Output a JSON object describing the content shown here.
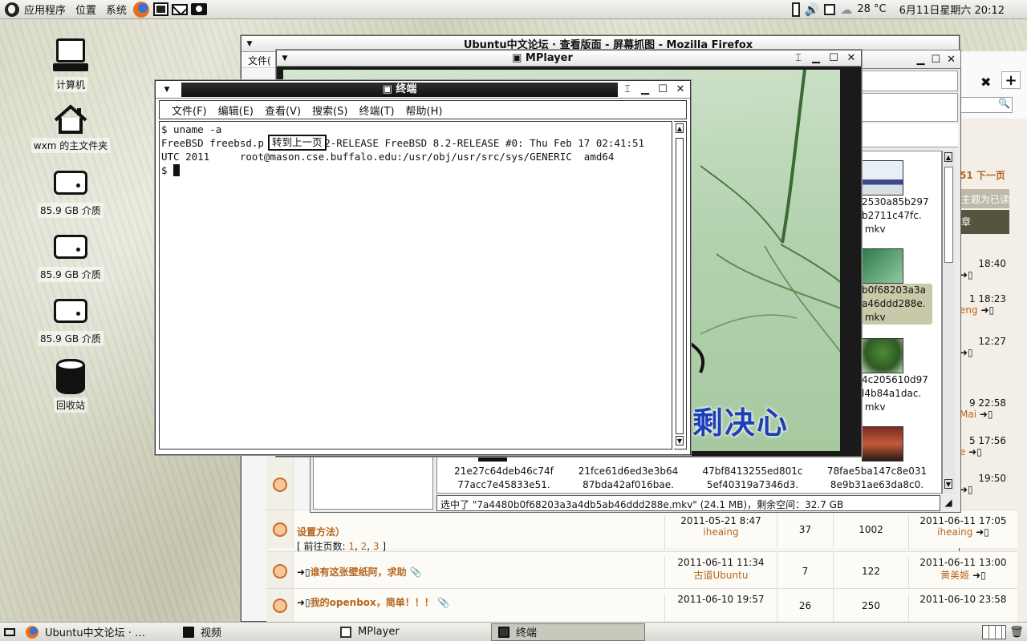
{
  "top_panel": {
    "menus": [
      "应用程序",
      "位置",
      "系统"
    ],
    "launchers": [
      "firefox-icon",
      "workspace-icon",
      "mail-icon",
      "camera-icon"
    ],
    "temperature": "28 °C",
    "datetime": "6月11日星期六 20:12"
  },
  "desktop": {
    "icons": [
      {
        "label": "计算机",
        "icon": "computer-icon"
      },
      {
        "label": "wxm 的主文件夹",
        "icon": "home-folder-icon"
      },
      {
        "label": "85.9 GB 介质",
        "icon": "drive-icon"
      },
      {
        "label": "85.9 GB 介质",
        "icon": "drive-icon"
      },
      {
        "label": "85.9 GB 介质",
        "icon": "drive-icon"
      },
      {
        "label": "回收站",
        "icon": "trash-icon"
      }
    ]
  },
  "firefox": {
    "title": "Ubuntu中文论坛 · 查看版面 - 屏幕抓图 - Mozilla Firefox",
    "menu_first": "文件(",
    "tab_close": "✖",
    "tab_add": "+",
    "next_page": "51 下一页",
    "mark_read": "主题为已读",
    "chapter": "章",
    "side_entries": [
      {
        "time": "18:40",
        "user": ""
      },
      {
        "time": "1 18:23",
        "user": "eng"
      },
      {
        "time": "12:27",
        "user": ""
      },
      {
        "time": "9 22:58",
        "user": "Mai"
      },
      {
        "time": "5 17:56",
        "user": "e"
      },
      {
        "time": "19:50",
        "user": ""
      }
    ],
    "rows": [
      {
        "subject": "设置方法）",
        "pages_prefix": "[ 前往页数: ",
        "pages": [
          "1",
          "2",
          "3"
        ],
        "pages_suffix": " ]",
        "created_date": "2011-05-21 8:47",
        "created_user": "iheaing",
        "replies": "37",
        "views": "1002",
        "last_date": "2011-06-11 17:05",
        "last_user": "iheaing"
      },
      {
        "subject": "谁有这张壁纸阿，求助",
        "pages_prefix": "",
        "pages": [],
        "pages_suffix": "",
        "created_date": "2011-06-11 11:34",
        "created_user": "古道Ubuntu",
        "replies": "7",
        "views": "122",
        "last_date": "2011-06-11 13:00",
        "last_user": "黄美姬"
      },
      {
        "subject": "我的openbox，简单！！！",
        "pages_prefix": "",
        "pages": [],
        "pages_suffix": "",
        "created_date": "2011-06-10 19:57",
        "created_user": "",
        "replies": "26",
        "views": "250",
        "last_date": "2011-06-10 23:58",
        "last_user": ""
      }
    ]
  },
  "file_chooser": {
    "thumbs_right": [
      {
        "lines": [
          "2530a85b297",
          "b2711c47fc.",
          "mkv"
        ],
        "selected": false
      },
      {
        "lines": [
          "b0f68203a3a",
          "a46ddd288e.",
          "mkv"
        ],
        "selected": true
      },
      {
        "lines": [
          "4c205610d97",
          "l4b84a1dac.",
          "mkv"
        ],
        "selected": false
      }
    ],
    "thumbs_bottom": [
      [
        "21e27c64deb46c74f",
        "77acc7e45833e51."
      ],
      [
        "21fce61d6ed3e3b64",
        "87bda42af016bae."
      ],
      [
        "47bf8413255ed801c",
        "5ef40319a7346d3."
      ],
      [
        "78fae5ba147c8e031",
        "8e9b31ae63da8c0."
      ]
    ],
    "status": "选中了 \"7a4480b0f68203a3a4db5ab46ddd288e.mkv\"  (24.1 MB)，剩余空间：32.7 GB"
  },
  "mplayer": {
    "title": "MPlayer",
    "subtitle": "剩决心"
  },
  "terminal": {
    "title": "终端",
    "menus": [
      "文件(F)",
      "编辑(E)",
      "查看(V)",
      "搜索(S)",
      "终端(T)",
      "帮助(H)"
    ],
    "lines": [
      "$ uname -a",
      "FreeBSD freebsd.p          2-RELEASE FreeBSD 8.2-RELEASE #0: Thu Feb 17 02:41:51",
      "UTC 2011     root@mason.cse.buffalo.edu:/usr/obj/usr/src/sys/GENERIC  amd64",
      "$ "
    ],
    "tooltip": "转到上一页"
  },
  "taskbar": {
    "tasks": [
      {
        "label": "Ubuntu中文论坛 · …",
        "icon": "firefox-icon",
        "active": false
      },
      {
        "label": "视频",
        "icon": "folder-icon",
        "active": false
      },
      {
        "label": "MPlayer",
        "icon": "window-icon",
        "active": false
      },
      {
        "label": "终端",
        "icon": "terminal-icon",
        "active": true
      }
    ]
  },
  "colors": {
    "accent_link": "#b5651d",
    "subtitle_blue": "#1d3fb7",
    "video_green": "#b2d2ae",
    "active_task": "#c8c8bc"
  }
}
